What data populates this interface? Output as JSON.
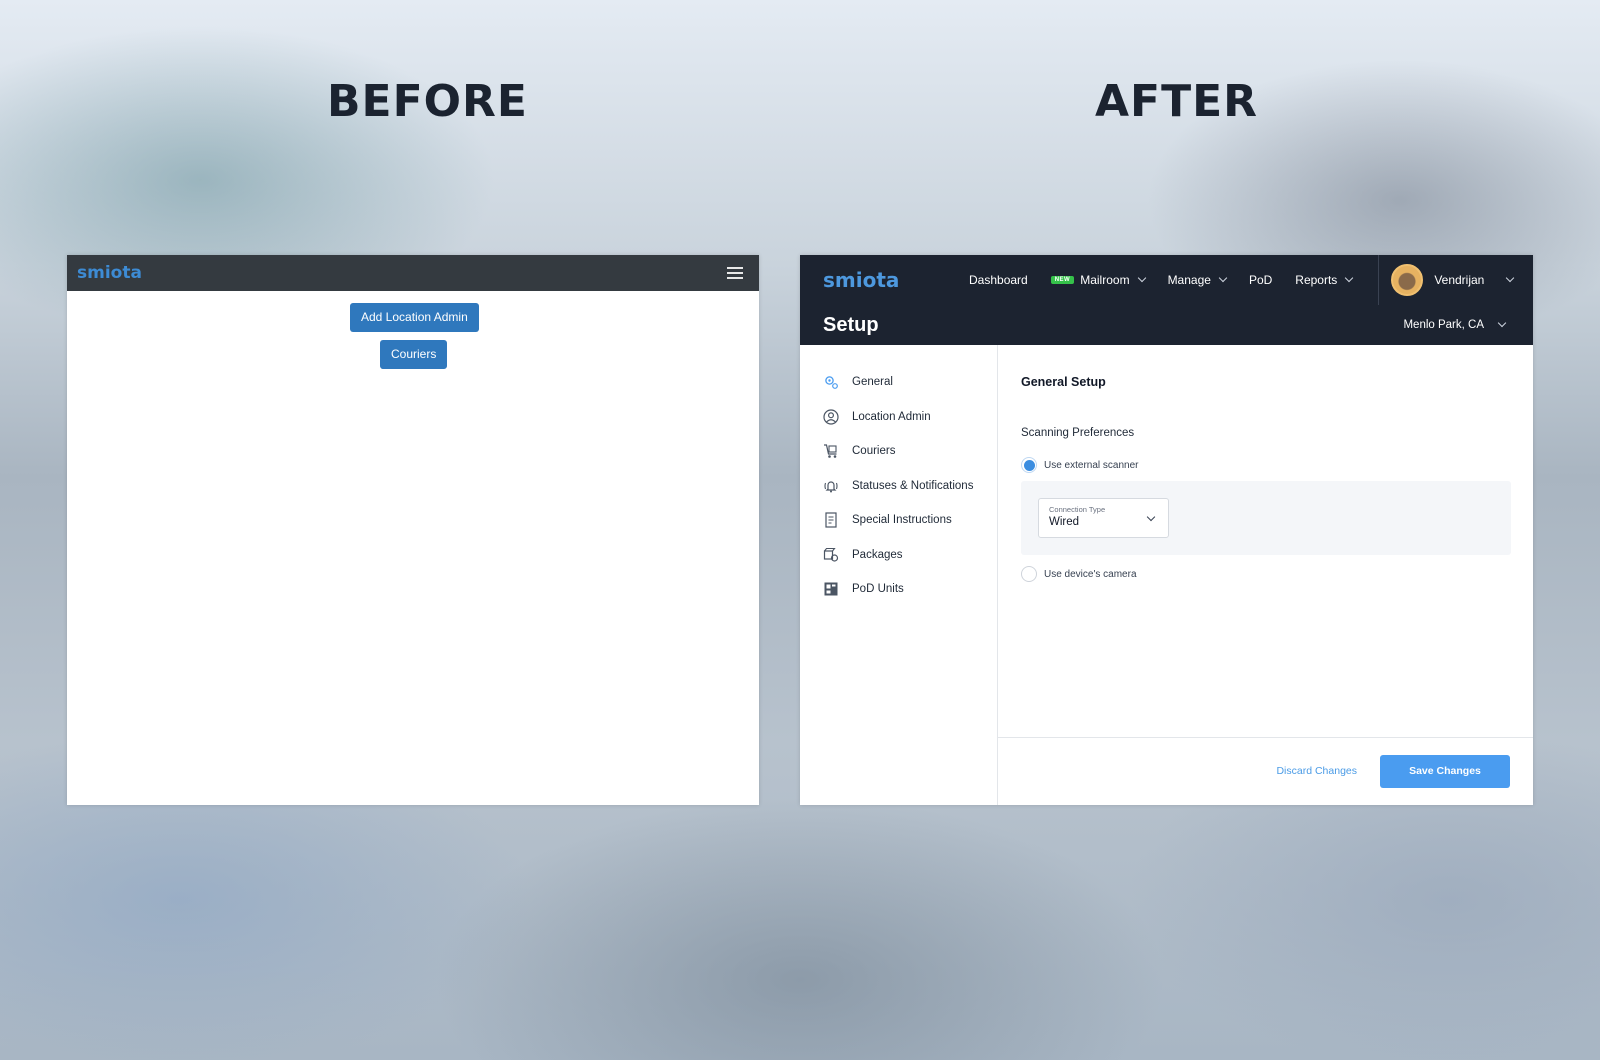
{
  "labels": {
    "before": "BEFORE",
    "after": "AFTER"
  },
  "before": {
    "logo": "smiota",
    "buttons": {
      "add_location_admin": "Add Location Admin",
      "couriers": "Couriers"
    }
  },
  "after": {
    "logo": "smiota",
    "nav": {
      "dashboard": "Dashboard",
      "new_badge": "NEW",
      "mailroom": "Mailroom",
      "manage": "Manage",
      "pod": "PoD",
      "reports": "Reports"
    },
    "user": {
      "name": "Vendrijan"
    },
    "header": {
      "title": "Setup",
      "location": "Menlo Park, CA"
    },
    "sidebar": {
      "items": [
        {
          "label": "General",
          "icon": "gear-icon"
        },
        {
          "label": "Location Admin",
          "icon": "user-circle-icon"
        },
        {
          "label": "Couriers",
          "icon": "cart-icon"
        },
        {
          "label": "Statuses & Notifications",
          "icon": "bell-icon"
        },
        {
          "label": "Special Instructions",
          "icon": "document-icon"
        },
        {
          "label": "Packages",
          "icon": "package-icon"
        },
        {
          "label": "PoD Units",
          "icon": "locker-icon"
        }
      ]
    },
    "main": {
      "title": "General Setup",
      "section": "Scanning Preferences",
      "option_external": "Use external scanner",
      "connection_caption": "Connection Type",
      "connection_value": "Wired",
      "option_camera": "Use device's camera"
    },
    "footer": {
      "discard": "Discard Changes",
      "save": "Save Changes"
    },
    "colors": {
      "nav_bg": "#1c2330",
      "accent": "#4a9cf0",
      "new_badge": "#35c24a"
    }
  }
}
